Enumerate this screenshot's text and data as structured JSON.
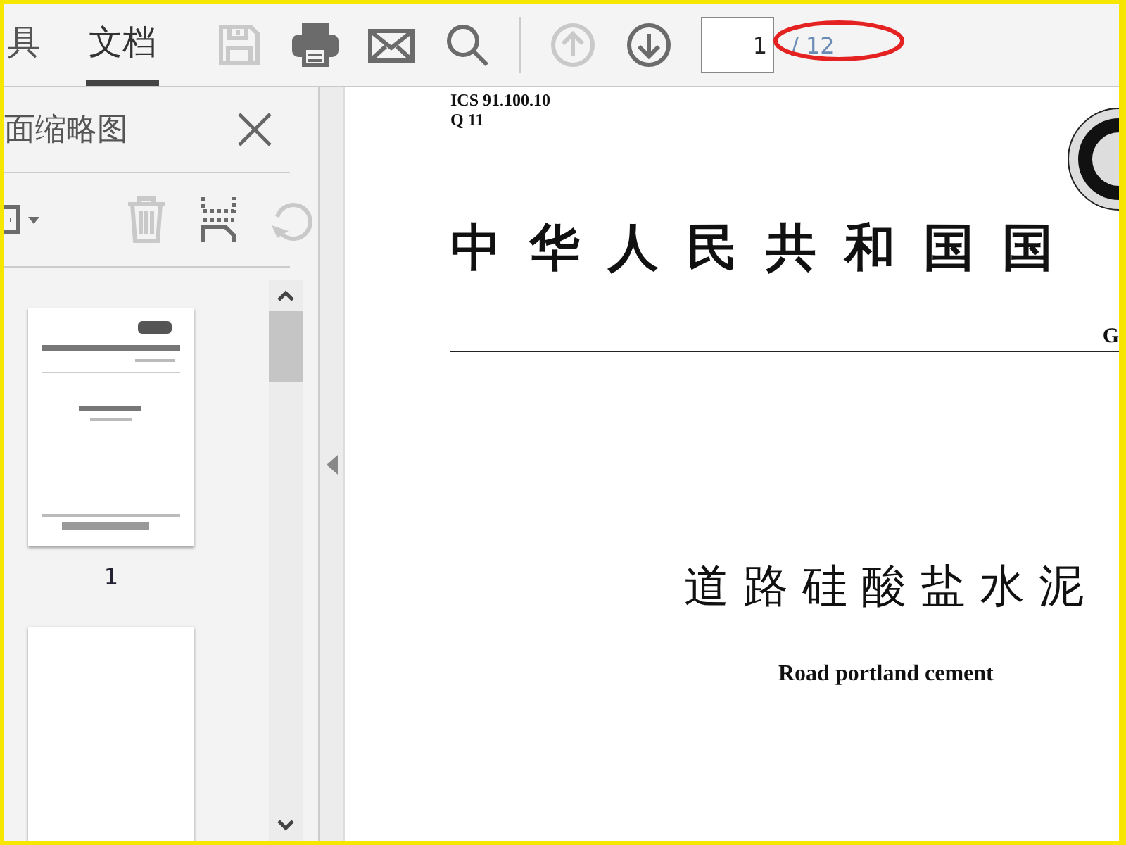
{
  "tabs": [
    {
      "label": "具",
      "selected": false
    },
    {
      "label": "文档",
      "selected": true
    }
  ],
  "toolbar": [
    {
      "kind": "save",
      "disabled": true
    },
    {
      "kind": "print",
      "disabled": false
    },
    {
      "kind": "mail",
      "disabled": false
    },
    {
      "kind": "search",
      "disabled": false
    },
    {
      "kind": "separator"
    },
    {
      "kind": "prev",
      "disabled": true
    },
    {
      "kind": "next",
      "disabled": false
    }
  ],
  "page_nav": {
    "current": "1",
    "total": "/ 12"
  },
  "thumbnail_panel": {
    "title": "面缩略图",
    "tools": [
      {
        "kind": "options",
        "disabled": false
      },
      {
        "kind": "separator"
      },
      {
        "kind": "delete",
        "disabled": true
      },
      {
        "kind": "extract",
        "disabled": false
      },
      {
        "kind": "rotate",
        "disabled": true
      }
    ],
    "pages": [
      {
        "kind": "cover",
        "label": "1"
      },
      {
        "kind": "blank"
      }
    ]
  },
  "document": {
    "ics": "ICS  91.100.10",
    "classification": "Q  11",
    "title": "中华人民共和国国",
    "code": "G",
    "name": "道路硅酸盐水泥",
    "name_en": "Road portland cement"
  }
}
